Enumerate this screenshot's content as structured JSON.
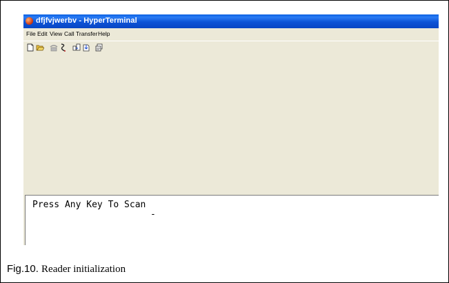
{
  "window": {
    "title": "dfjfvjwerbv - HyperTerminal"
  },
  "menu": {
    "items": [
      "File",
      "Edit",
      "View",
      "Call",
      "Transfer",
      "Help"
    ]
  },
  "toolbar": {
    "icons": [
      "new-document-icon",
      "open-folder-icon",
      "phone-call-icon",
      "disconnect-icon",
      "send-file-icon",
      "receive-file-icon",
      "properties-icon"
    ]
  },
  "terminal": {
    "line1": "Press Any Key To Scan",
    "cursor": "-"
  },
  "caption": {
    "fig": "Fig.10.",
    "text": "Reader initialization"
  }
}
